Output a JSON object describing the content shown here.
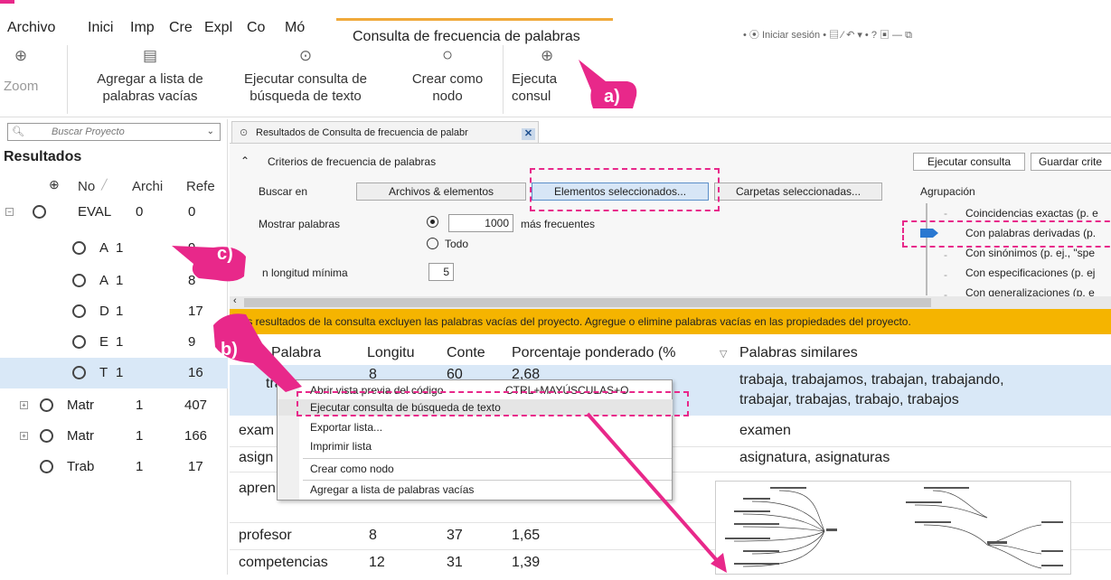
{
  "menubar": {
    "items": [
      "Archivo",
      "Inici",
      "Imp",
      "Cre",
      "Expl",
      "Co",
      "Mó"
    ],
    "active_tab": "Consulta de frecuencia de palabras",
    "right_tools": "• ⦿ Iniciar sesión • ▤ ⁄ ↶ ▾ • ? ▣ — ⧉"
  },
  "ribbon": {
    "zoom": "Zoom",
    "add_stopwords_1": "Agregar a lista de",
    "add_stopwords_2": "palabras vacías",
    "run_text_query_1": "Ejecutar consulta de",
    "run_text_query_2": "búsqueda de texto",
    "create_node_1": "Crear como",
    "create_node_2": "nodo",
    "run_query_1": "Ejecuta",
    "run_query_2": "consul"
  },
  "search": {
    "placeholder": "Buscar Proyecto"
  },
  "left": {
    "title": "Resultados",
    "col_name": "No",
    "col_files": "Archi",
    "col_refs": "Refe",
    "rows": [
      {
        "name": "EVAL",
        "files": "0",
        "refs": "0"
      },
      {
        "name": "A",
        "files": "1",
        "refs": "9"
      },
      {
        "name": "A",
        "files": "1",
        "refs": "8"
      },
      {
        "name": "D",
        "files": "1",
        "refs": "17"
      },
      {
        "name": "E",
        "files": "1",
        "refs": "9"
      },
      {
        "name": "T",
        "files": "1",
        "refs": "16"
      },
      {
        "name": "Matr",
        "files": "1",
        "refs": "407"
      },
      {
        "name": "Matr",
        "files": "1",
        "refs": "166"
      },
      {
        "name": "Trab",
        "files": "1",
        "refs": "17"
      }
    ]
  },
  "result_tab": {
    "title": "Resultados de Consulta de frecuencia de palabr"
  },
  "criteria": {
    "header": "Criterios de frecuencia de palabras",
    "run_button": "Ejecutar consulta",
    "save_button": "Guardar crite",
    "search_in": "Buscar en",
    "files_btn": "Archivos & elementos",
    "selected_btn": "Elementos seleccionados...",
    "folders_btn": "Carpetas seleccionadas...",
    "grouping": "Agrupación",
    "show_words": "Mostrar palabras",
    "top_value": "1000",
    "most_frequent": "más frecuentes",
    "all": "Todo",
    "min_length_label": "n longitud mínima",
    "min_length": "5",
    "groups": [
      "Coincidencias exactas (p. e",
      "Con palabras derivadas (p.",
      "Con sinónimos (p. ej., \"spe",
      "Con especificaciones (p. ej",
      "Con generalizaciones (p. e"
    ],
    "group_selected_index": 1
  },
  "notice": "Los resultados de la consulta excluyen las palabras vacías del proyecto. Agregue o elimine palabras vacías en las propiedades del proyecto.",
  "table": {
    "headers": [
      "Palabra",
      "Longitu",
      "Conte",
      "Porcentaje ponderado (%",
      "Palabras similares"
    ],
    "rows": [
      {
        "word": "traba",
        "len": "8",
        "count": "60",
        "pct": "2,68",
        "sim1": "trabaja, trabajamos, trabajan, trabajando,",
        "sim2": "trabajar, trabajas, trabajo, trabajos"
      },
      {
        "word": "exam",
        "len": "",
        "count": "",
        "pct": "",
        "sim1": "examen",
        "sim2": ""
      },
      {
        "word": "asign",
        "len": "",
        "count": "",
        "pct": "",
        "sim1": "asignatura, asignaturas",
        "sim2": ""
      },
      {
        "word": "apren",
        "len": "",
        "count": "",
        "pct": "",
        "sim1": "",
        "sim2": ""
      },
      {
        "word": "profesor",
        "len": "8",
        "count": "37",
        "pct": "1,65",
        "sim1": "",
        "sim2": ""
      },
      {
        "word": "competencias",
        "len": "12",
        "count": "31",
        "pct": "1,39",
        "sim1": "",
        "sim2": ""
      }
    ]
  },
  "context_menu": {
    "items": [
      {
        "label": "Abrir vista previa del código",
        "shortcut": "CTRL+MAYÚSCULAS+O"
      },
      {
        "label": "Ejecutar consulta de búsqueda de texto",
        "shortcut": ""
      },
      {
        "label": "Exportar lista...",
        "shortcut": ""
      },
      {
        "label": "Imprimir lista",
        "shortcut": ""
      },
      {
        "label": "Crear como nodo",
        "shortcut": ""
      },
      {
        "label": "Agregar a lista de palabras vacías",
        "shortcut": ""
      }
    ]
  },
  "annotations": {
    "a": "a)",
    "b": "b)",
    "c": "c)"
  },
  "colors": {
    "accent": "#e8288a",
    "notice": "#f5b400",
    "selection": "#d9e8f7",
    "tab_accent": "#f0a93b"
  }
}
